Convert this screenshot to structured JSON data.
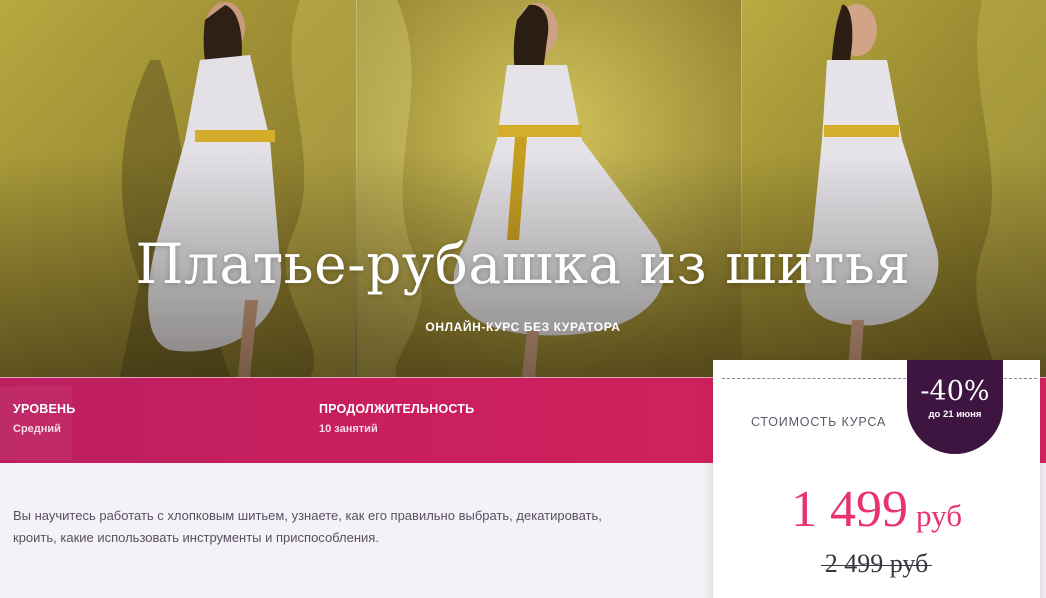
{
  "hero": {
    "title": "Платье-рубашка из шитья",
    "subtitle": "ОНЛАЙН-КУРС БЕЗ КУРАТОРА",
    "background_color": "#a49434"
  },
  "info": {
    "items": [
      {
        "label": "УРОВЕНЬ",
        "value": "Средний"
      },
      {
        "label": "ПРОДОЛЖИТЕЛЬНОСТЬ",
        "value": "10 занятий"
      }
    ],
    "accent_color": "#c81f5d"
  },
  "description": "Вы научитесь работать с хлопковым шитьем, узнаете, как его правильно выбрать, декатировать, кроить, какие использовать инструменты и приспособления.",
  "price": {
    "label": "СТОИМОСТЬ КУРСА",
    "discount": "-40%",
    "discount_note": "до 21 июня",
    "current": "1 499",
    "currency": "руб",
    "old": "2 499 руб",
    "current_color": "#e8336d",
    "badge_color": "#3e1540"
  }
}
